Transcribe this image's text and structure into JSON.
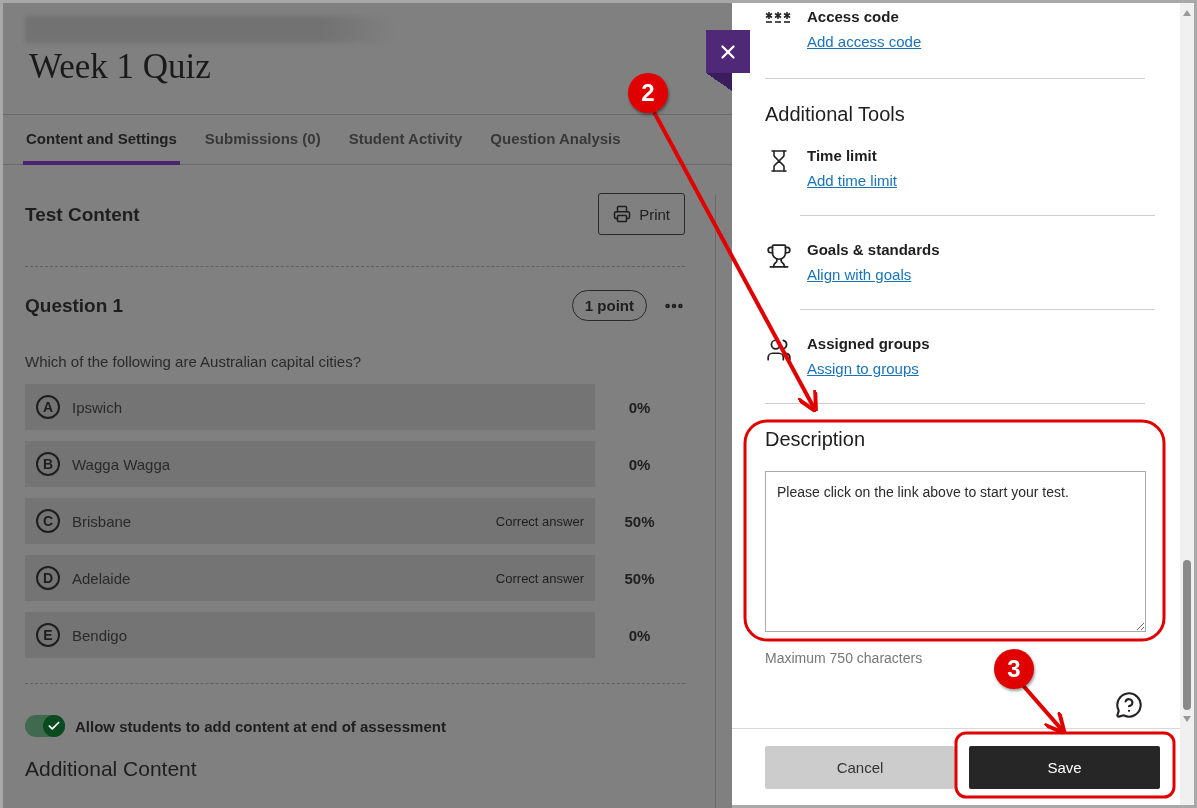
{
  "page": {
    "title": "Week 1 Quiz",
    "tabs": [
      {
        "label": "Content and Settings",
        "selected": true
      },
      {
        "label": "Submissions (0)",
        "selected": false
      },
      {
        "label": "Student Activity",
        "selected": false
      },
      {
        "label": "Question Analysis",
        "selected": false
      }
    ],
    "test_content": {
      "heading": "Test Content",
      "print_button": "Print",
      "question": {
        "title": "Question 1",
        "points": "1 point",
        "text": "Which of the following are Australian capital cities?",
        "options": [
          {
            "letter": "A",
            "text": "Ipswich",
            "percent": "0%"
          },
          {
            "letter": "B",
            "text": "Wagga Wagga",
            "percent": "0%"
          },
          {
            "letter": "C",
            "text": "Brisbane",
            "note": "Correct answer",
            "percent": "50%"
          },
          {
            "letter": "D",
            "text": "Adelaide",
            "note": "Correct answer",
            "percent": "50%"
          },
          {
            "letter": "E",
            "text": "Bendigo",
            "percent": "0%"
          }
        ]
      },
      "toggle": {
        "label": "Allow students to add content at end of assessment",
        "on": true
      },
      "additional_heading": "Additional Content"
    }
  },
  "settings_panel": {
    "access_code": {
      "kind": "code",
      "title": "Access code",
      "link": "Add access code"
    },
    "additional_tools": {
      "heading": "Additional Tools",
      "items": [
        {
          "kind": "timer",
          "title": "Time limit",
          "link": "Add time limit"
        },
        {
          "kind": "goals",
          "title": "Goals & standards",
          "link": "Align with goals"
        },
        {
          "kind": "groups",
          "title": "Assigned groups",
          "link": "Assign to groups"
        }
      ]
    },
    "description": {
      "heading": "Description",
      "value": "Please click on the link above to start your test.",
      "hint": "Maximum 750 characters"
    },
    "buttons": [
      {
        "label": "Cancel",
        "kind": "secondary"
      },
      {
        "label": "Save",
        "kind": "primary"
      }
    ]
  },
  "annotations": [
    {
      "label": "2"
    },
    {
      "label": "3"
    }
  ]
}
